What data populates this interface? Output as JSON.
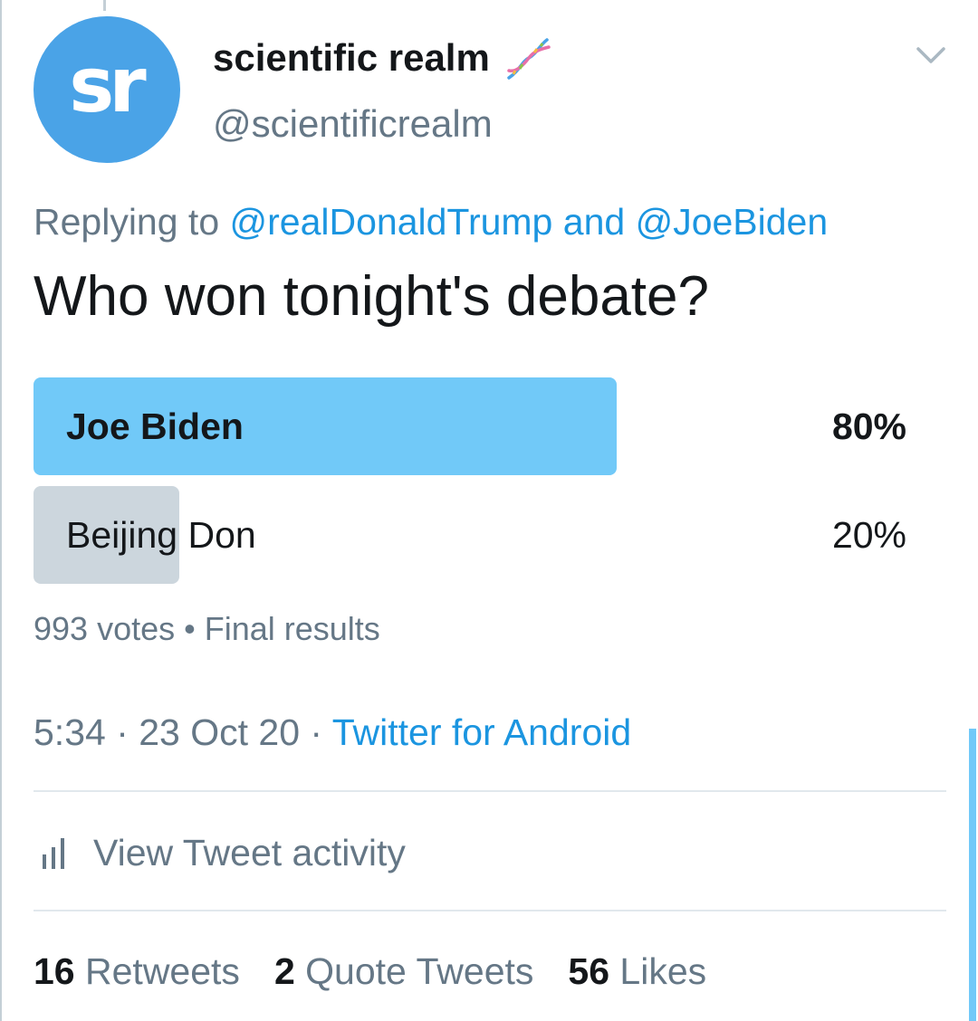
{
  "tweet": {
    "author": {
      "avatar_text": "sr",
      "display_name": "scientific realm",
      "handle": "@scientificrealm",
      "name_emoji": "dna-icon"
    },
    "menu_icon": "chevron-down-icon",
    "replying": {
      "prefix": "Replying to ",
      "user1": "@realDonaldTrump",
      "conjunction": " and ",
      "user2": "@JoeBiden"
    },
    "text": "Who won tonight's debate?",
    "poll": {
      "options": [
        {
          "label": "Joe Biden",
          "percent_label": "80%",
          "fraction": 0.8,
          "winner": true
        },
        {
          "label": "Beijing Don",
          "percent_label": "20%",
          "fraction": 0.2,
          "winner": false
        }
      ],
      "votes": "993 votes",
      "separator": " • ",
      "status": "Final results"
    },
    "time": "5:34",
    "date": "23 Oct 20",
    "dot": " · ",
    "source": "Twitter for Android",
    "activity_label": "View Tweet activity",
    "activity_icon": "bar-chart-icon",
    "stats": [
      {
        "count": "16",
        "label": "Retweets"
      },
      {
        "count": "2",
        "label": "Quote Tweets"
      },
      {
        "count": "56",
        "label": "Likes"
      }
    ]
  },
  "colors": {
    "link": "#1b95e0",
    "secondary_text": "#657786",
    "poll_winner": "#71c9f8",
    "poll_other": "#ccd6dd",
    "avatar": "#4aa3e7"
  }
}
